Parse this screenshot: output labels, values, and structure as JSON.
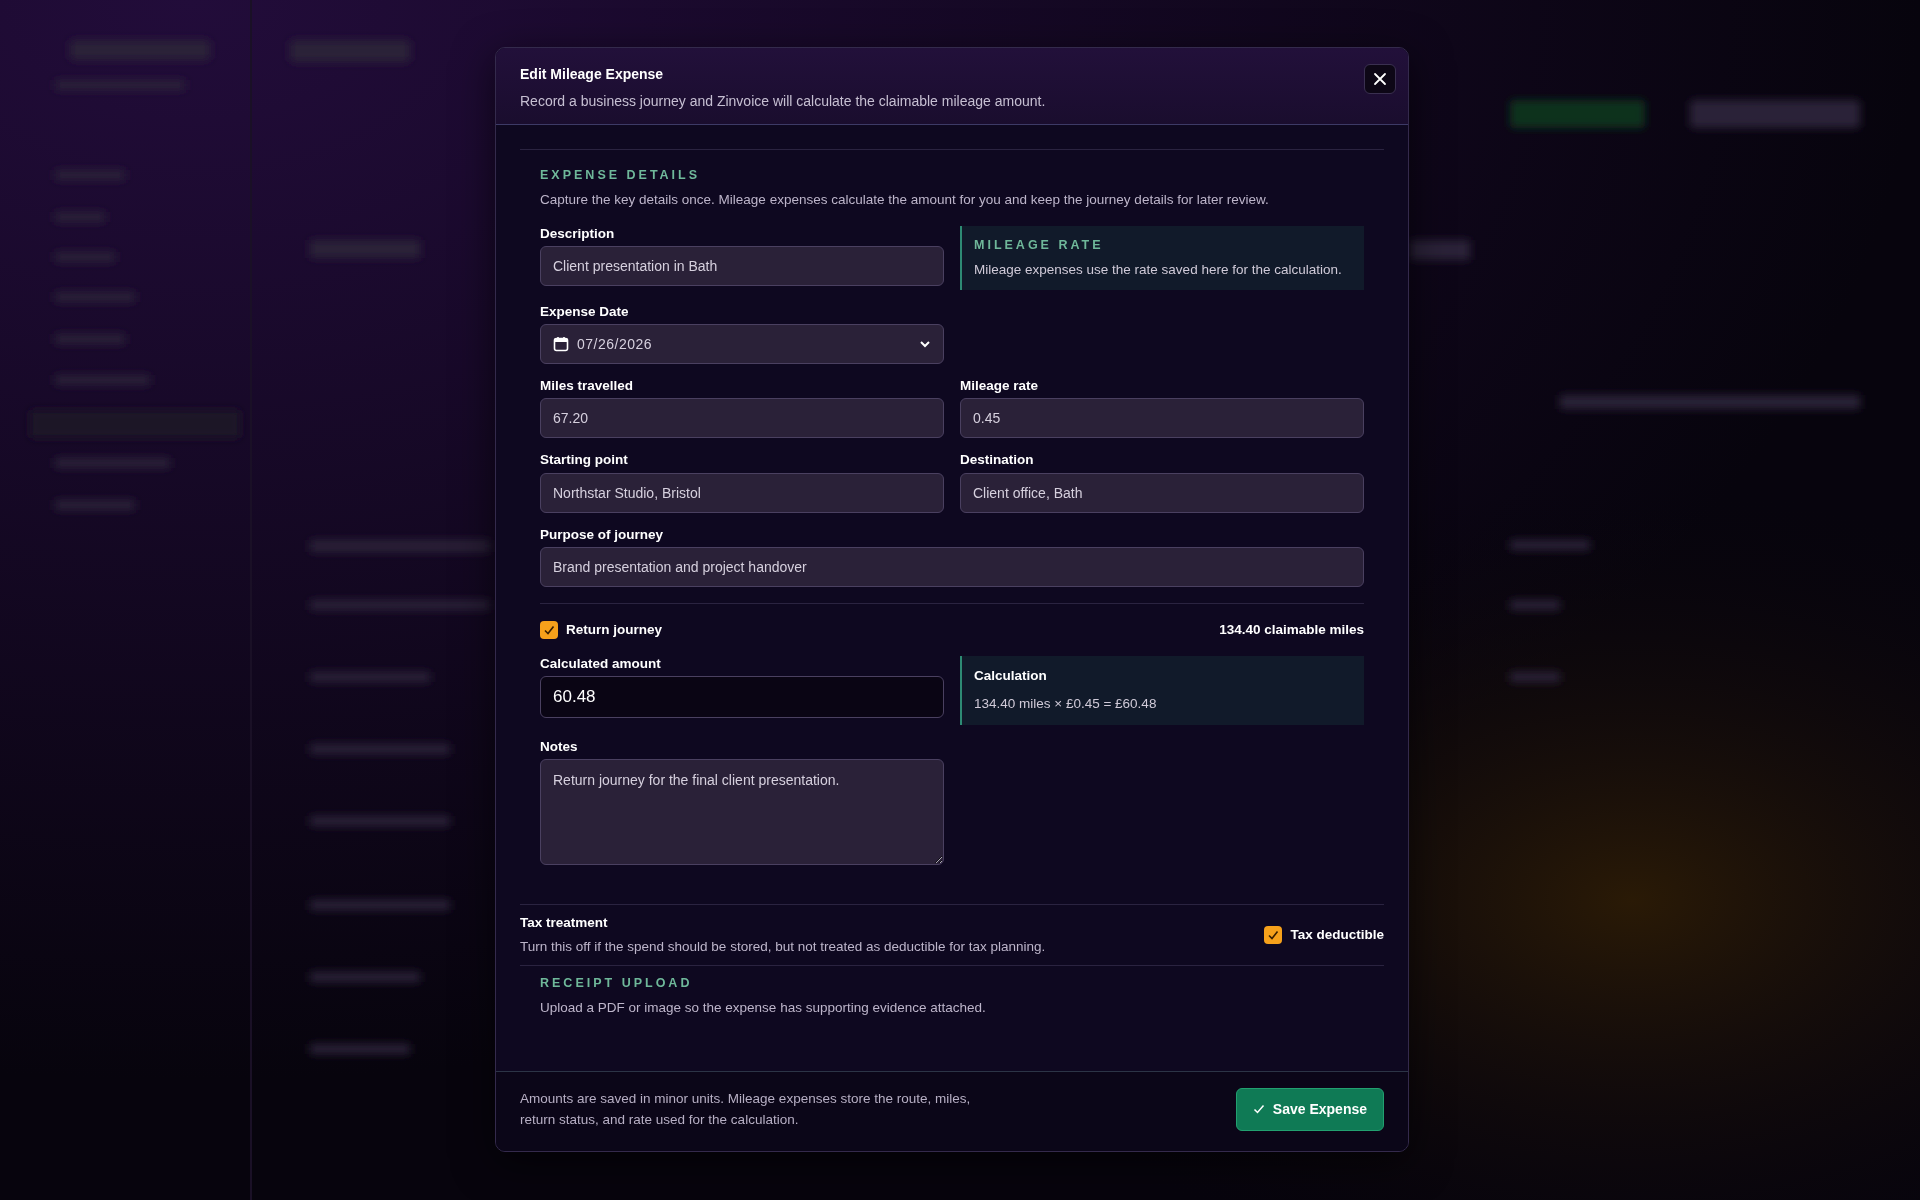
{
  "modal": {
    "title": "Edit Mileage Expense",
    "subtitle": "Record a business journey and Zinvoice will calculate the claimable mileage amount."
  },
  "details": {
    "heading": "EXPENSE DETAILS",
    "description": "Capture the key details once. Mileage expenses calculate the amount for you and keep the journey details for later review."
  },
  "description_field": {
    "label": "Description",
    "value": "Client presentation in Bath"
  },
  "rate_note": {
    "heading": "MILEAGE RATE",
    "text": "Mileage expenses use the rate saved here for the calculation."
  },
  "expense_date": {
    "label": "Expense Date",
    "value": "07/26/2026"
  },
  "miles": {
    "label": "Miles travelled",
    "value": "67.20"
  },
  "rate": {
    "label": "Mileage rate",
    "value": "0.45"
  },
  "start": {
    "label": "Starting point",
    "value": "Northstar Studio, Bristol"
  },
  "destination": {
    "label": "Destination",
    "value": "Client office, Bath"
  },
  "purpose": {
    "label": "Purpose of journey",
    "value": "Brand presentation and project handover"
  },
  "return_journey": {
    "label": "Return journey",
    "checked": true
  },
  "claimable_miles": "134.40 claimable miles",
  "calculated_amount": {
    "label": "Calculated amount",
    "value": "60.48"
  },
  "calculation": {
    "heading": "Calculation",
    "text": "134.40 miles × £0.45 = £60.48"
  },
  "notes": {
    "label": "Notes",
    "value": "Return journey for the final client presentation."
  },
  "tax": {
    "heading": "Tax treatment",
    "description": "Turn this off if the spend should be stored, but not treated as deductible for tax planning.",
    "checkbox": {
      "label": "Tax deductible",
      "checked": true
    }
  },
  "receipt": {
    "heading": "RECEIPT UPLOAD",
    "description": "Upload a PDF or image so the expense has supporting evidence attached."
  },
  "footer": {
    "note": "Amounts are saved in minor units. Mileage expenses store the route, miles, return status, and rate used for the calculation.",
    "button": "Save Expense"
  }
}
